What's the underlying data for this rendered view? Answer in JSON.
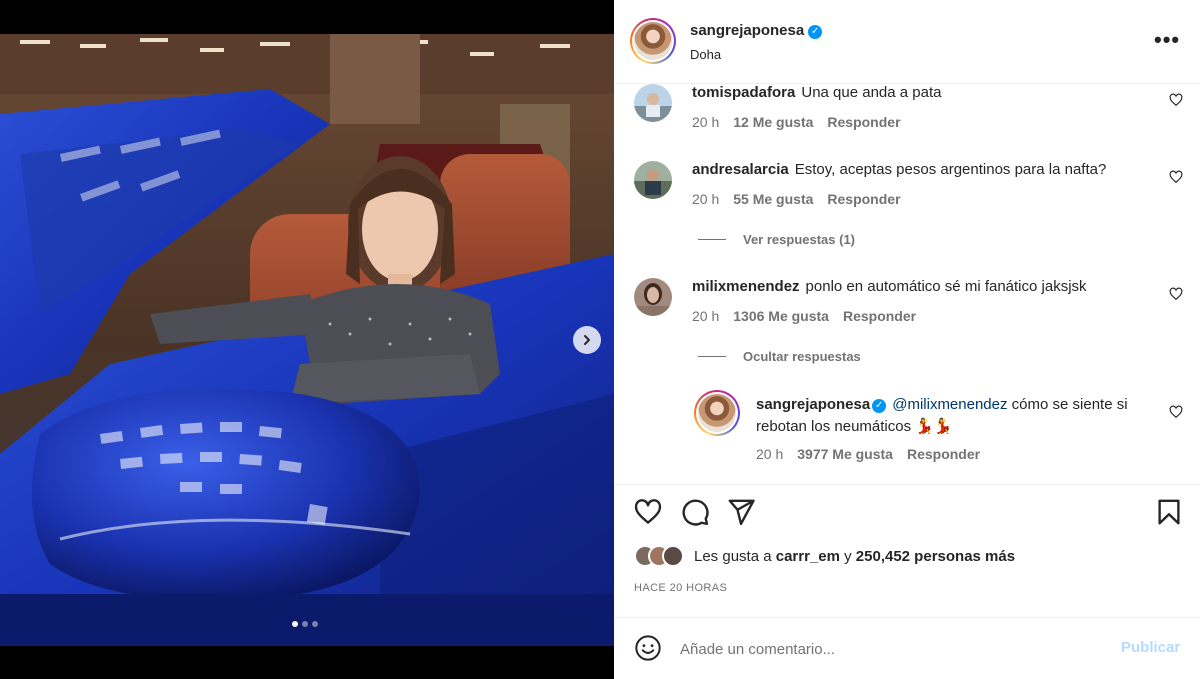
{
  "post": {
    "author": "sangrejaponesa",
    "location": "Doha",
    "more_label": "•••"
  },
  "carousel": {
    "slide_count": 3,
    "active_index": 0
  },
  "comments": [
    {
      "user": "tomispadafora",
      "text": "Una que anda a pata",
      "time": "20 h",
      "likes": "12 Me gusta",
      "reply_label": "Responder"
    },
    {
      "user": "andresalarcia",
      "text": "Estoy, aceptas pesos argentinos para la nafta?",
      "time": "20 h",
      "likes": "55 Me gusta",
      "reply_label": "Responder",
      "thread_label": "Ver respuestas (1)"
    },
    {
      "user": "milixmenendez",
      "text": "ponlo en automático sé mi fanático jaksjsk",
      "time": "20 h",
      "likes": "1306 Me gusta",
      "reply_label": "Responder",
      "thread_label": "Ocultar respuestas"
    }
  ],
  "reply": {
    "user": "sangrejaponesa",
    "mention": "@milixmenendez",
    "text": " cómo se siente si rebotan los neumáticos 💃💃",
    "time": "20 h",
    "likes": "3977 Me gusta",
    "reply_label": "Responder"
  },
  "engagement": {
    "liked_by_prefix": "Les gusta a ",
    "liked_by_user": "carrr_em",
    "liked_by_join": " y ",
    "liked_by_count": "250,452 personas más",
    "timestamp": "HACE 20 HORAS"
  },
  "composer": {
    "placeholder": "Añade un comentario...",
    "publish_label": "Publicar"
  },
  "icons": {
    "like": "heart-icon",
    "comment": "comment-icon",
    "share": "send-icon",
    "save": "bookmark-icon",
    "emoji": "emoji-icon",
    "next": "chevron-right-icon",
    "verified": "verified-icon"
  },
  "colors": {
    "link": "#00376b",
    "meta": "#737373",
    "publish_disabled": "#b3dbff",
    "verified": "#0095f6"
  }
}
